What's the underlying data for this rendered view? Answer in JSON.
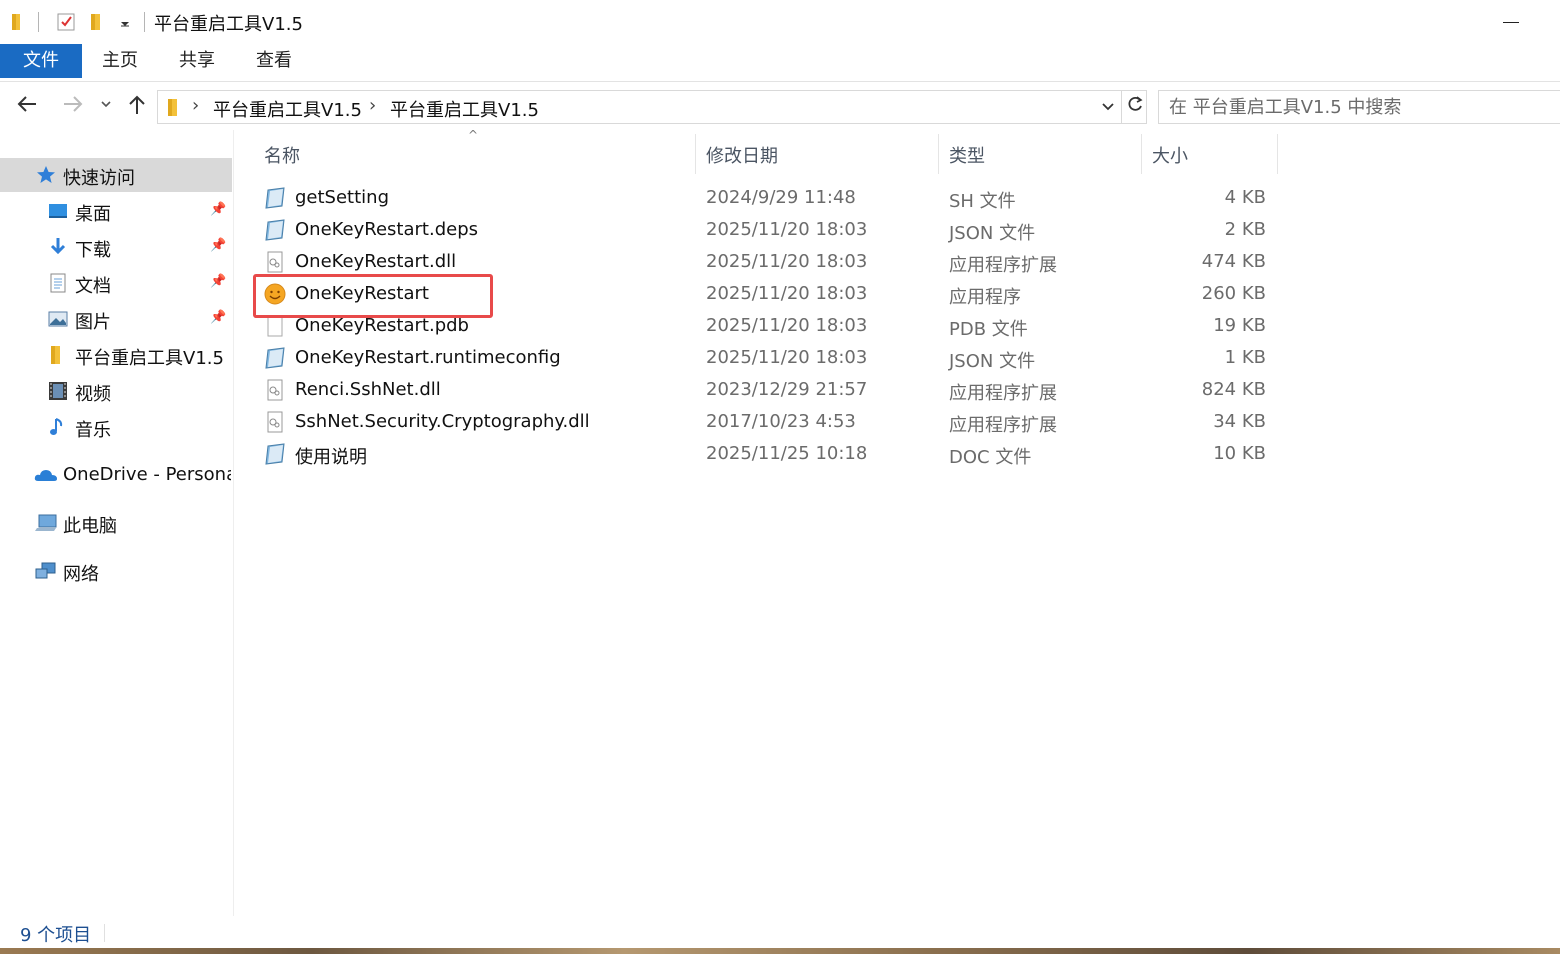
{
  "window": {
    "title": "平台重启工具V1.5"
  },
  "ribbon": {
    "tabs": [
      {
        "label": "文件"
      },
      {
        "label": "主页"
      },
      {
        "label": "共享"
      },
      {
        "label": "查看"
      }
    ]
  },
  "address": {
    "breadcrumbs": [
      "平台重启工具V1.5",
      "平台重启工具V1.5"
    ],
    "search_placeholder": "在 平台重启工具V1.5 中搜索"
  },
  "sidebar": {
    "items": [
      {
        "label": "快速访问",
        "icon": "star-icon",
        "selected": true
      },
      {
        "label": "桌面",
        "icon": "desktop-icon",
        "pinned": true
      },
      {
        "label": "下载",
        "icon": "download-icon",
        "pinned": true
      },
      {
        "label": "文档",
        "icon": "document-icon",
        "pinned": true
      },
      {
        "label": "图片",
        "icon": "picture-icon",
        "pinned": true
      },
      {
        "label": "平台重启工具V1.5",
        "icon": "folder-icon"
      },
      {
        "label": "视频",
        "icon": "video-icon"
      },
      {
        "label": "音乐",
        "icon": "music-icon"
      },
      {
        "label": "OneDrive - Personal",
        "icon": "onedrive-icon"
      },
      {
        "label": "此电脑",
        "icon": "computer-icon"
      },
      {
        "label": "网络",
        "icon": "network-icon"
      }
    ]
  },
  "columns": {
    "name": "名称",
    "date": "修改日期",
    "type": "类型",
    "size": "大小"
  },
  "files": [
    {
      "name": "getSetting",
      "date": "2024/9/29 11:48",
      "type": "SH 文件",
      "size": "4 KB",
      "icon": "generic-file-icon"
    },
    {
      "name": "OneKeyRestart.deps",
      "date": "2025/11/20 18:03",
      "type": "JSON 文件",
      "size": "2 KB",
      "icon": "generic-file-icon"
    },
    {
      "name": "OneKeyRestart.dll",
      "date": "2025/11/20 18:03",
      "type": "应用程序扩展",
      "size": "474 KB",
      "icon": "dll-file-icon"
    },
    {
      "name": "OneKeyRestart",
      "date": "2025/11/20 18:03",
      "type": "应用程序",
      "size": "260 KB",
      "icon": "smiley-app-icon"
    },
    {
      "name": "OneKeyRestart.pdb",
      "date": "2025/11/20 18:03",
      "type": "PDB 文件",
      "size": "19 KB",
      "icon": "blank-file-icon"
    },
    {
      "name": "OneKeyRestart.runtimeconfig",
      "date": "2025/11/20 18:03",
      "type": "JSON 文件",
      "size": "1 KB",
      "icon": "generic-file-icon"
    },
    {
      "name": "Renci.SshNet.dll",
      "date": "2023/12/29 21:57",
      "type": "应用程序扩展",
      "size": "824 KB",
      "icon": "dll-file-icon"
    },
    {
      "name": "SshNet.Security.Cryptography.dll",
      "date": "2017/10/23 4:53",
      "type": "应用程序扩展",
      "size": "34 KB",
      "icon": "dll-file-icon"
    },
    {
      "name": "使用说明",
      "date": "2025/11/25 10:18",
      "type": "DOC 文件",
      "size": "10 KB",
      "icon": "generic-file-icon"
    }
  ],
  "status": {
    "count": "9 个项目"
  },
  "colors": {
    "accent": "#1a6bc3",
    "highlight": "#e84a4a",
    "selected_nav": "#d9d9d9"
  }
}
